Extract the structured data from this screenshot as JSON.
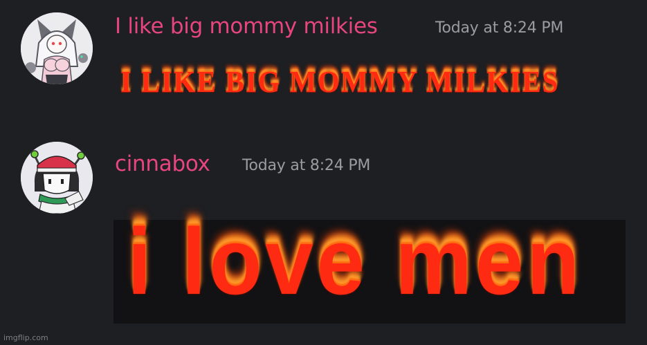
{
  "messages": [
    {
      "username": "I like big mommy milkies",
      "timestamp": "Today at 8:24 PM",
      "content": "I LIKE BIG MOMMY MILKIES",
      "avatar_icon": "anime-character-avatar-icon"
    },
    {
      "username": "cinnabox",
      "timestamp": "Today at 8:24 PM",
      "content": "i love men",
      "avatar_icon": "cave-story-character-avatar-icon"
    }
  ],
  "watermark": "imgflip.com",
  "colors": {
    "background": "#1e1f22",
    "username": "#e7467d",
    "timestamp": "#9a9ca3",
    "fire_red": "#ff2a12",
    "fire_orange": "#ff9b2f"
  }
}
